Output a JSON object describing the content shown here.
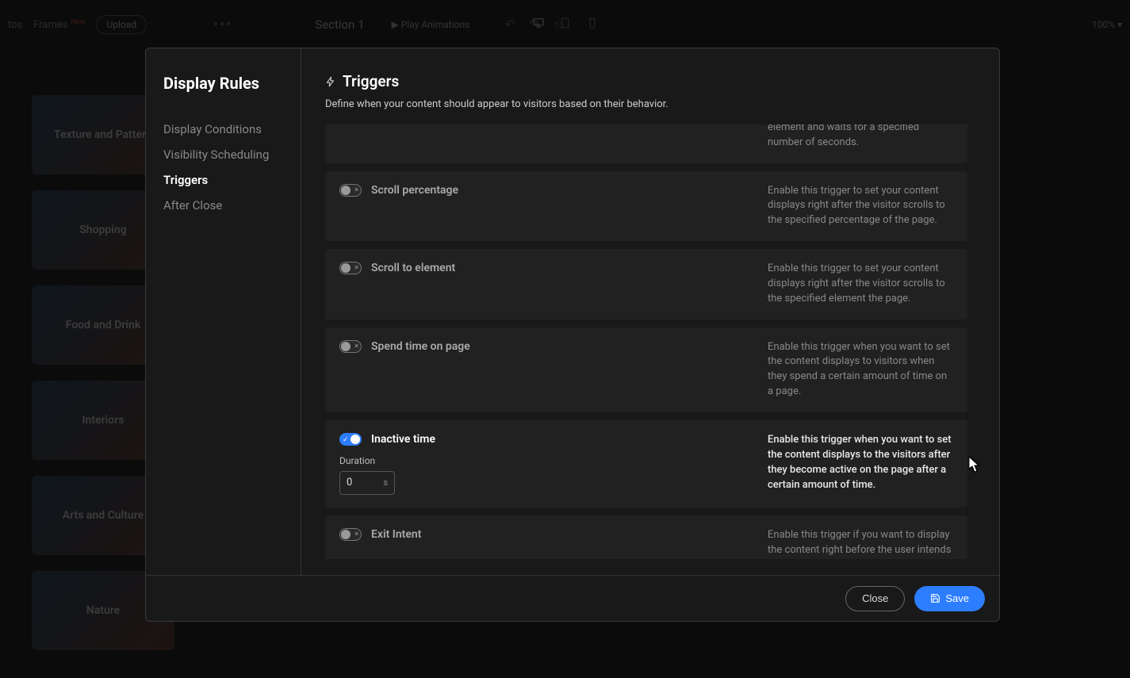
{
  "bg": {
    "frames_label": "Frames",
    "frames_badge": "New",
    "upload_label": "Upload",
    "section_label": "Section 1",
    "play_label": "Play Animations",
    "zoom": "100%",
    "cards": [
      "Texture and Pattern",
      "Shopping",
      "Food and Drink",
      "Interiors",
      "Arts and Culture",
      "Nature"
    ]
  },
  "modal": {
    "title": "Display Rules",
    "nav": [
      {
        "label": "Display Conditions",
        "active": false
      },
      {
        "label": "Visibility Scheduling",
        "active": false
      },
      {
        "label": "Triggers",
        "active": true
      },
      {
        "label": "After Close",
        "active": false
      }
    ],
    "section_title": "Triggers",
    "section_subtitle": "Define when your content should appear to visitors based on their behavior.",
    "triggers": [
      {
        "id": "hover",
        "partial_top": true,
        "enabled": false,
        "title": "",
        "desc": "display after a visitor hovers over an element and waits for a specified number of seconds."
      },
      {
        "id": "scroll-percentage",
        "enabled": false,
        "title": "Scroll percentage",
        "desc": "Enable this trigger to set your content displays right after the visitor scrolls to the specified percentage of the page."
      },
      {
        "id": "scroll-element",
        "enabled": false,
        "title": "Scroll to element",
        "desc": "Enable this trigger to set your content displays right after the visitor scrolls to the specified element the page."
      },
      {
        "id": "spend-time",
        "enabled": false,
        "title": "Spend time on page",
        "desc": "Enable this trigger when you want to set the content displays to visitors when they spend a certain amount of time on a page."
      },
      {
        "id": "inactive-time",
        "enabled": true,
        "title": "Inactive time",
        "desc": "Enable this trigger when you want to set the content displays to the visitors after they become active on the page after a certain amount of time.",
        "duration_label": "Duration",
        "duration_value": "0",
        "duration_unit": "s"
      },
      {
        "id": "exit-intent",
        "enabled": false,
        "title": "Exit Intent",
        "desc": "Enable this trigger if you want to display the content right before the user intends to leave the page. This trigger would be helpful if you want to decrease the cart abundance rate."
      }
    ],
    "footer": {
      "close": "Close",
      "save": "Save"
    }
  }
}
